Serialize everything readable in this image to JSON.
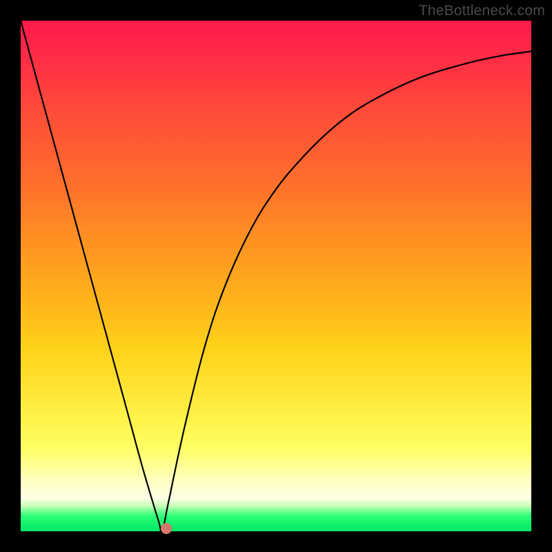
{
  "watermark": "TheBottleneck.com",
  "chart_data": {
    "type": "line",
    "title": "",
    "xlabel": "",
    "ylabel": "",
    "xlim": [
      0,
      100
    ],
    "ylim": [
      0,
      100
    ],
    "series": [
      {
        "name": "bottleneck-curve",
        "x": [
          0,
          3,
          6,
          9,
          12,
          15,
          18,
          21,
          24,
          27,
          27.7,
          29,
          32,
          36,
          40,
          45,
          50,
          55,
          60,
          65,
          70,
          75,
          80,
          85,
          90,
          95,
          100
        ],
        "y": [
          100,
          89,
          78,
          67,
          56,
          45,
          34,
          23,
          12,
          2,
          0,
          6,
          20,
          36,
          48,
          59,
          67,
          73,
          78,
          82,
          85,
          87.5,
          89.5,
          91,
          92.3,
          93.3,
          94
        ]
      }
    ],
    "marker": {
      "x": 28.5,
      "y": 0.5,
      "color": "#d4786b"
    },
    "background_gradient": {
      "top": "#ff1a4b",
      "mid": "#ffd21a",
      "bottom": "#00e765"
    }
  }
}
